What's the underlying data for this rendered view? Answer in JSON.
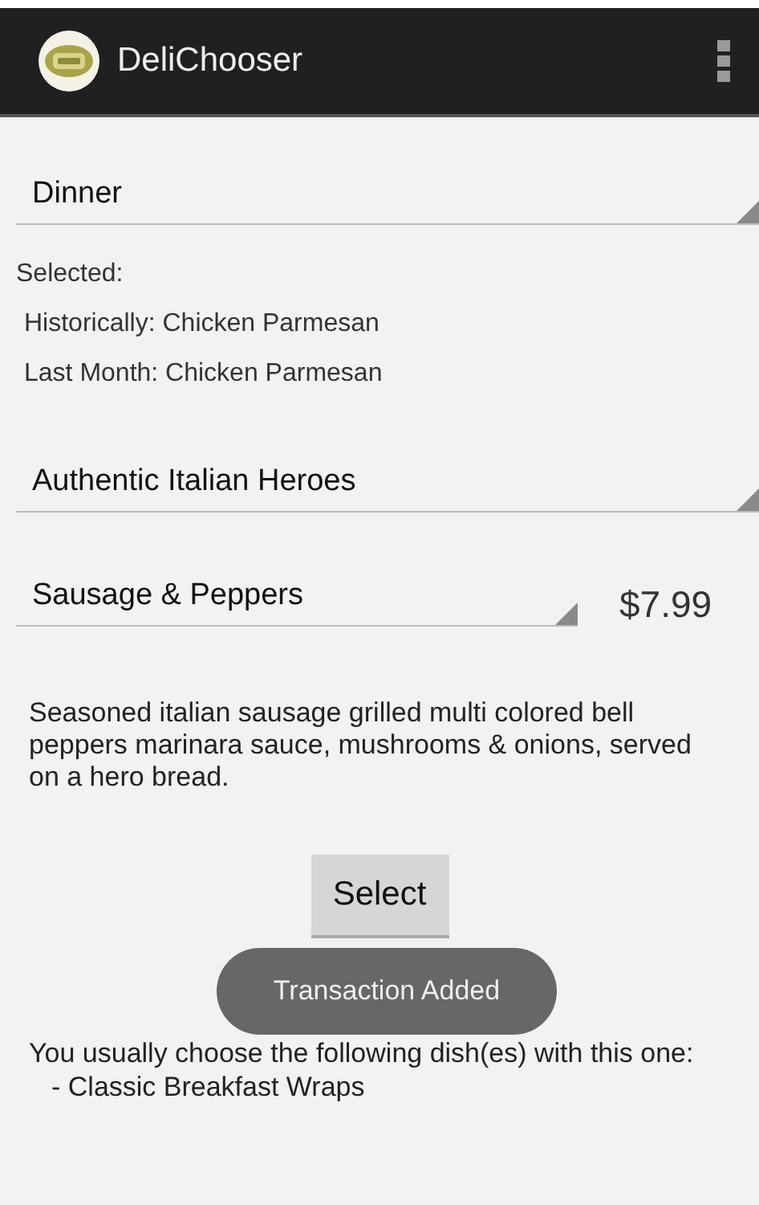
{
  "app_bar": {
    "title": "DeliChooser"
  },
  "meal_spinner": {
    "value": "Dinner"
  },
  "selected_label": "Selected:",
  "history": [
    "Historically: Chicken Parmesan",
    "Last Month: Chicken Parmesan"
  ],
  "category_spinner": {
    "value": "Authentic Italian Heroes"
  },
  "dish_spinner": {
    "value": "Sausage & Peppers"
  },
  "price": "$7.99",
  "description": "Seasoned italian sausage grilled multi colored bell peppers marinara sauce, mushrooms & onions, served on a hero bread.",
  "select_button": "Select",
  "toast": "Transaction Added",
  "suggestion": {
    "text": "You usually choose the following dish(es) with this one:",
    "items": [
      "- Classic Breakfast Wraps"
    ]
  }
}
